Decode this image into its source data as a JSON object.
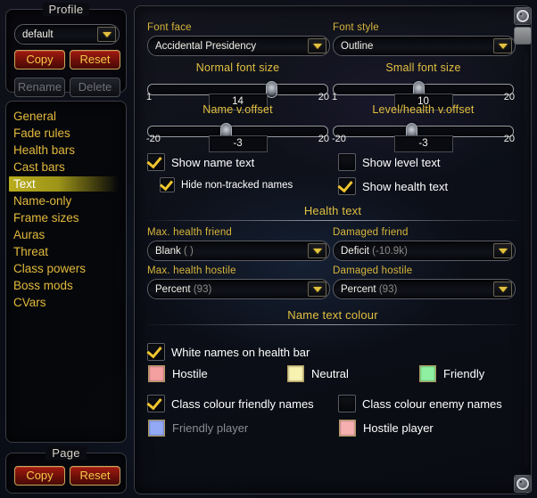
{
  "profile": {
    "frame_title": "Profile",
    "dropdown_value": "default",
    "copy_label": "Copy",
    "reset_label": "Reset",
    "rename_label": "Rename",
    "delete_label": "Delete"
  },
  "sidebar": {
    "items": [
      {
        "label": "General",
        "selected": false
      },
      {
        "label": "Fade rules",
        "selected": false
      },
      {
        "label": "Health bars",
        "selected": false
      },
      {
        "label": "Cast bars",
        "selected": false
      },
      {
        "label": "Text",
        "selected": true
      },
      {
        "label": "Name-only",
        "selected": false
      },
      {
        "label": "Frame sizes",
        "selected": false
      },
      {
        "label": "Auras",
        "selected": false
      },
      {
        "label": "Threat",
        "selected": false
      },
      {
        "label": "Class powers",
        "selected": false
      },
      {
        "label": "Boss mods",
        "selected": false
      },
      {
        "label": "CVars",
        "selected": false
      }
    ]
  },
  "page": {
    "frame_title": "Page",
    "copy_label": "Copy",
    "reset_label": "Reset"
  },
  "main": {
    "font_face": {
      "label": "Font face",
      "value": "Accidental Presidency"
    },
    "font_style": {
      "label": "Font style",
      "value": "Outline"
    },
    "normal_font_size": {
      "label": "Normal font size",
      "value": "14",
      "min": "1",
      "max": "20",
      "percent": 68
    },
    "small_font_size": {
      "label": "Small font size",
      "value": "10",
      "min": "1",
      "max": "20",
      "percent": 47
    },
    "name_voffset": {
      "label": "Name v.offset",
      "value": "-3",
      "min": "-20",
      "max": "20",
      "percent": 43
    },
    "level_health_voffset": {
      "label": "Level/health v.offset",
      "value": "-3",
      "min": "-20",
      "max": "20",
      "percent": 43
    },
    "checks": {
      "show_name_text": {
        "label": "Show name text",
        "checked": true
      },
      "show_level_text": {
        "label": "Show level text",
        "checked": false
      },
      "hide_non_tracked_names": {
        "label": "Hide non-tracked names",
        "checked": true
      },
      "show_health_text": {
        "label": "Show health text",
        "checked": true
      }
    },
    "health_text": {
      "section_title": "Health text",
      "max_health_friend": {
        "label": "Max. health friend",
        "value": "Blank",
        "detail": "( )"
      },
      "damaged_friend": {
        "label": "Damaged friend",
        "value": "Deficit",
        "detail": "(-10.9k)"
      },
      "max_health_hostile": {
        "label": "Max. health hostile",
        "value": "Percent",
        "detail": "(93)"
      },
      "damaged_hostile": {
        "label": "Damaged hostile",
        "value": "Percent",
        "detail": "(93)"
      }
    },
    "name_text_colour": {
      "section_title": "Name text colour",
      "white_names": {
        "label": "White names on health bar",
        "checked": true
      },
      "swatches": [
        {
          "label": "Hostile",
          "color": "#f4a0a0"
        },
        {
          "label": "Neutral",
          "color": "#f8f2b0"
        },
        {
          "label": "Friendly",
          "color": "#8ef0a0"
        }
      ],
      "class_colour_friendly": {
        "label": "Class colour friendly names",
        "checked": true
      },
      "class_colour_enemy": {
        "label": "Class colour enemy names",
        "checked": false
      },
      "friendly_player": {
        "label": "Friendly player",
        "color": "#93a9f5",
        "dim": true
      },
      "hostile_player": {
        "label": "Hostile player",
        "color": "#f6b0b0",
        "dim": false
      }
    }
  },
  "corner": {
    "gear_top": "gear-icon",
    "plain_top": "panel-icon",
    "gear_bottom": "gear-icon"
  }
}
